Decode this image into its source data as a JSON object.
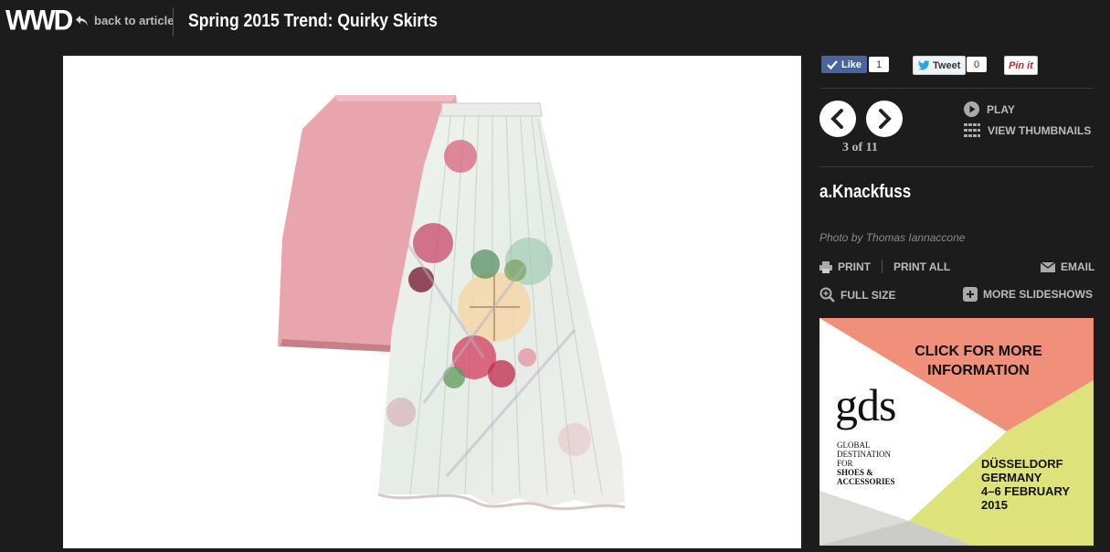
{
  "header": {
    "logo": "WWD",
    "back_label": "back to article",
    "title": "Spring 2015 Trend: Quirky Skirts"
  },
  "social": {
    "like_label": "Like",
    "like_count": "1",
    "tweet_label": "Tweet",
    "tweet_count": "0",
    "pin_label": "Pin it"
  },
  "slideshow": {
    "counter": "3 of 11",
    "play_label": "PLAY",
    "thumbnails_label": "VIEW THUMBNAILS",
    "designer": "a.Knackfuss",
    "credit": "Photo by Thomas Iannaccone"
  },
  "actions": {
    "print": "PRINT",
    "print_all": "PRINT ALL",
    "email": "EMAIL",
    "full_size": "FULL SIZE",
    "more_slideshows": "MORE SLIDESHOWS"
  },
  "ad": {
    "cta_line1": "CLICK FOR MORE",
    "cta_line2": "INFORMATION",
    "brand": "gds",
    "tag1": "GLOBAL",
    "tag2": "DESTINATION",
    "tag3": "FOR",
    "tag4": "SHOES &",
    "tag5": "ACCESSORIES",
    "city": "DÜSSELDORF",
    "country": "GERMANY",
    "dates": "4–6 FEBRUARY",
    "year": "2015"
  },
  "colors": {
    "background": "#1c1c1c",
    "ad_salmon": "#f0907a",
    "ad_lime": "#dde27a",
    "ad_gray": "#cccbc7",
    "skirt_pink": "#e8a5ad"
  }
}
